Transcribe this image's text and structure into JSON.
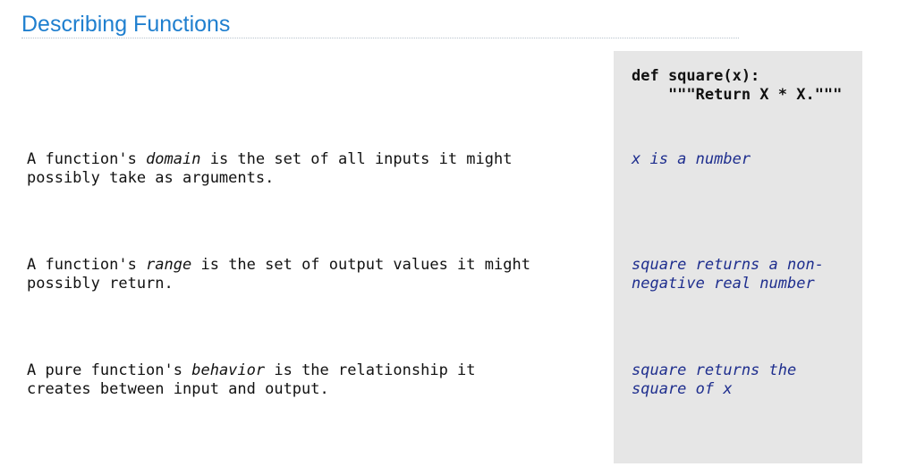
{
  "slide": {
    "title": "Describing Functions"
  },
  "code": {
    "signature": "def square(x):",
    "docstring": "    \"\"\"Return X * X.\"\"\""
  },
  "rows": [
    {
      "desc_before": "A function's ",
      "term": "domain",
      "desc_after": " is the set of all inputs it might\npossibly take as arguments.",
      "example": "x is a number"
    },
    {
      "desc_before": "A function's ",
      "term": "range",
      "desc_after": " is the set of output values it might\npossibly return.",
      "example": "square returns a non-\nnegative real number"
    },
    {
      "desc_before": "A pure function's ",
      "term": "behavior",
      "desc_after": " is the relationship it\ncreates between input and output.",
      "example": "square returns the\nsquare of x"
    }
  ]
}
